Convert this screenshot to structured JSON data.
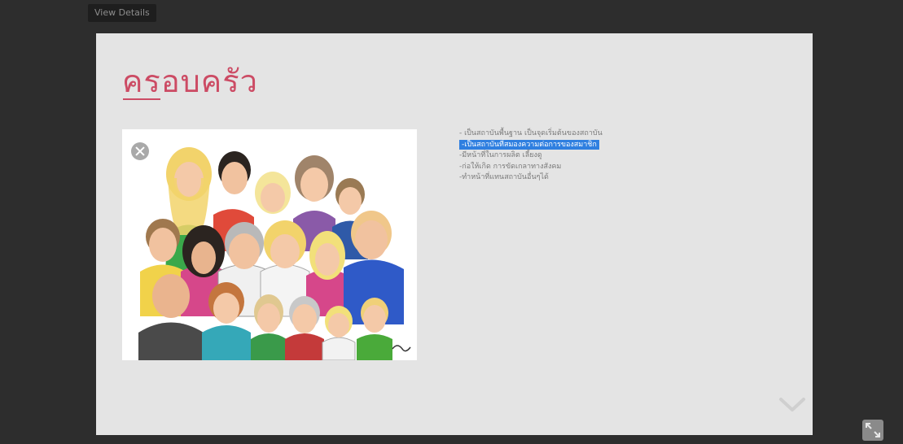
{
  "toolbar": {
    "view_details_label": "View Details"
  },
  "slide": {
    "title": "ครอบครัว",
    "bullets": [
      "- เป็นสถาบันพื้นฐาน เป็นจุดเริ่มต้นของสถาบัน",
      "-เป็นสถาบันที่สมองความต่อการของสมาชิก",
      "-มีหน้าที่ในการผลิต เลี้ยงดู",
      "-ก่อให้เกิด การขัดเกลาทางสังคม",
      "-ทำหน้าที่แทนสถาบันอื่นๆได้"
    ],
    "highlighted_bullet_index": 1
  },
  "icons": {
    "close": "close-icon",
    "next": "chevron-down-icon",
    "fullscreen": "expand-icon"
  },
  "colors": {
    "title": "#cc4b64",
    "highlight": "#2f7fe0",
    "slide_background": "#e4e4e4",
    "page_background": "#2d2d2d"
  }
}
